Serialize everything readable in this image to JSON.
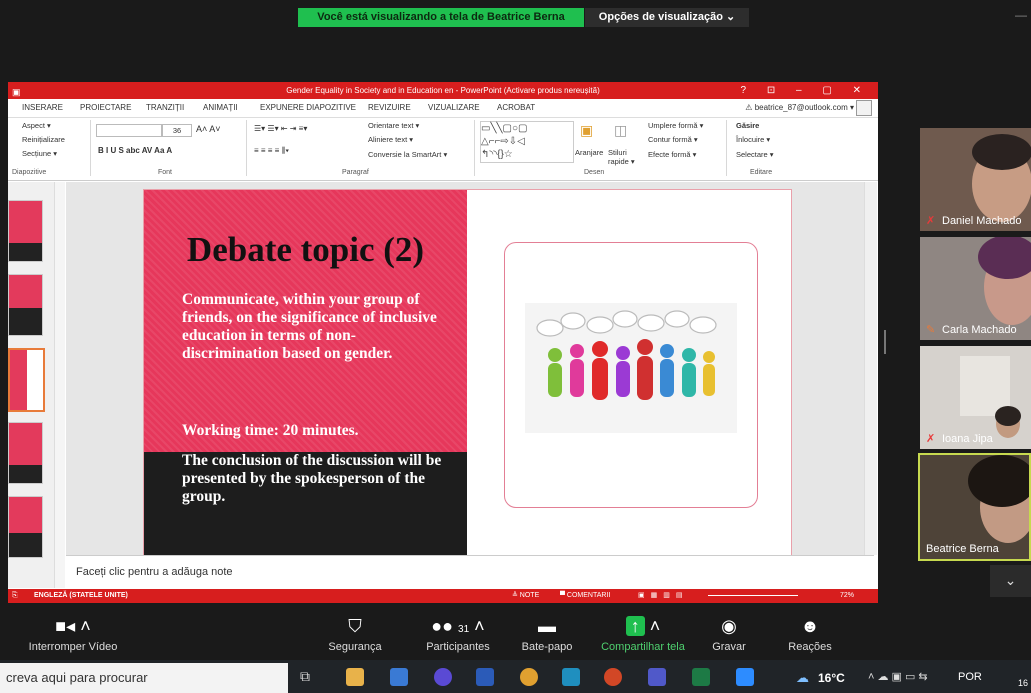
{
  "zoom_top": {
    "share_banner": "Você está visualizando a tela de Beatrice Berna",
    "view_options": "Opções de visualização ⌄",
    "minimize": "—"
  },
  "ppt": {
    "window_title": "Gender Equality in Society and in Education en -  PowerPoint (Activare produs nereușită)",
    "window_controls": "? ⊡ – ▢ ✕",
    "tabs": [
      "INSERARE",
      "PROIECTARE",
      "TRANZIȚII",
      "ANIMAȚII",
      "EXPUNERE DIAPOZITIVE",
      "REVIZUIRE",
      "VIZUALIZARE",
      "ACROBAT"
    ],
    "account": "⚠ beatrice_87@outlook.com ▾",
    "ribbon": {
      "aspect": "Aspect ▾",
      "reset": "Reinițializare",
      "section": "Secțiune ▾",
      "group_slides": "Diapozitive",
      "font_size": "36",
      "group_font": "Font",
      "text_orientation": "Orientare text ▾",
      "align_text": "Aliniere text ▾",
      "smartart": "Conversie la SmartArt ▾",
      "group_paragraph": "Paragraf",
      "arrange": "Aranjare",
      "quick_styles": "Stiluri rapide ▾",
      "shape_fill": "Umplere formă ▾",
      "shape_outline": "Contur formă ▾",
      "shape_effects": "Efecte formă ▾",
      "group_drawing": "Desen",
      "find": "Găsire",
      "replace": "Înlocuire ▾",
      "select": "Selectare ▾",
      "group_editing": "Editare"
    },
    "slide": {
      "title": "Debate topic (2)",
      "body": "Communicate, within your group of friends,  on the significance of inclusive education in terms of non-discrimination based on gender.",
      "working_time": "Working time: 20 minutes.",
      "conclusion": "The conclusion of the discussion will be presented by the spokesperson of the group."
    },
    "notes_placeholder": "Faceți clic pentru a adăuga note",
    "status": {
      "language": "ENGLEZĂ (STATELE UNITE)",
      "notes": "≜ NOTE",
      "comments": "▀ COMENTARII",
      "zoom": "72%"
    }
  },
  "participants": [
    {
      "name": "Daniel Machado",
      "bg": "#6f5a4e"
    },
    {
      "name": "Carla Machado",
      "bg": "#8a7d78"
    },
    {
      "name": "Ioana Jipa",
      "bg": "#c9c6c2"
    },
    {
      "name": "Beatrice Berna",
      "bg": "#4e4338"
    }
  ],
  "toolbar": {
    "video": "Interromper Vídeo",
    "security": "Segurança",
    "participants": "Participantes",
    "participant_count": "31",
    "chat": "Bate-papo",
    "share": "Compartilhar tela",
    "record": "Gravar",
    "reactions": "Reações"
  },
  "taskbar": {
    "search": "creva aqui para procurar",
    "weather": "16°C",
    "lang": "POR",
    "time": "16"
  },
  "colors": {
    "ppt_red": "#d71e1e",
    "slide_pink": "#e6375b",
    "zoom_green": "#1fbf4f",
    "active_border": "#c7d94f"
  }
}
